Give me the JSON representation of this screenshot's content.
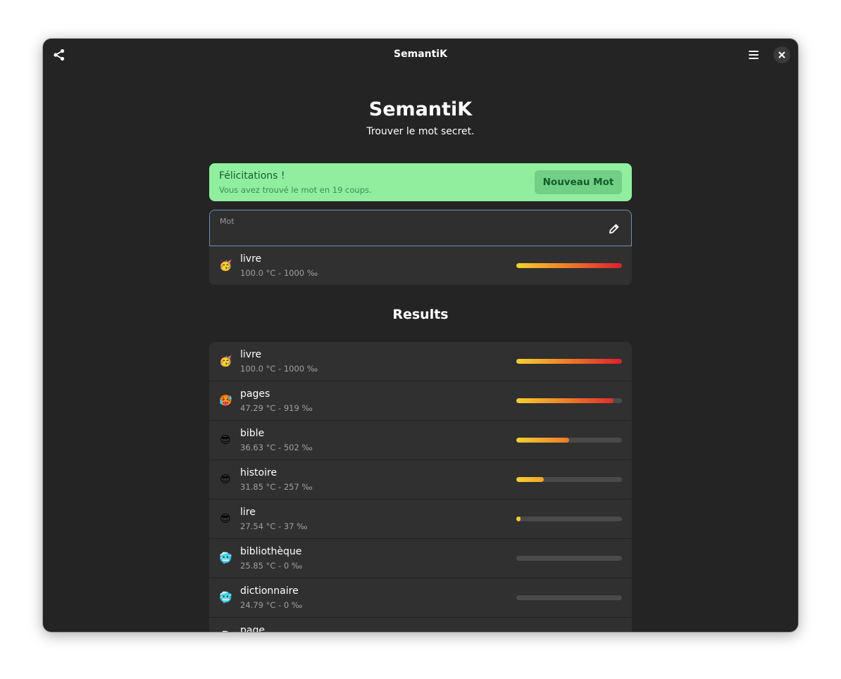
{
  "window": {
    "title": "SemantiK"
  },
  "header": {
    "title": "SemantiK",
    "subtitle": "Trouver le mot secret."
  },
  "banner": {
    "title": "Félicitations !",
    "subtitle": "Vous avez trouvé le mot en 19 coups.",
    "button_label": "Nouveau Mot"
  },
  "entry": {
    "label": "Mot",
    "value": ""
  },
  "current_guess": {
    "emoji": "🥳",
    "word": "livre",
    "meta": "100.0 °C - 1000 ‰",
    "permille": 1000
  },
  "results": {
    "title": "Results",
    "items": [
      {
        "emoji": "🥳",
        "word": "livre",
        "meta": "100.0 °C - 1000 ‰",
        "permille": 1000
      },
      {
        "emoji": "🥵",
        "word": "pages",
        "meta": "47.29 °C - 919 ‰",
        "permille": 919
      },
      {
        "emoji": "😎",
        "word": "bible",
        "meta": "36.63 °C - 502 ‰",
        "permille": 502
      },
      {
        "emoji": "😎",
        "word": "histoire",
        "meta": "31.85 °C - 257 ‰",
        "permille": 257
      },
      {
        "emoji": "😎",
        "word": "lire",
        "meta": "27.54 °C - 37 ‰",
        "permille": 37
      },
      {
        "emoji": "🥶",
        "word": "bibliothèque",
        "meta": "25.85 °C - 0 ‰",
        "permille": 0
      },
      {
        "emoji": "🥶",
        "word": "dictionnaire",
        "meta": "24.79 °C - 0 ‰",
        "permille": 0
      },
      {
        "emoji": "🥶",
        "word": "page",
        "meta": "",
        "permille": 0
      }
    ]
  },
  "colors": {
    "window_bg": "#242424",
    "card_bg": "#303030",
    "success_bg": "#8fef9f",
    "success_button": "#72cf86",
    "bar_start": "#f5d031",
    "bar_end": "#dd1f2c"
  },
  "icons": {
    "share": "share-icon",
    "menu": "hamburger-menu-icon",
    "close": "close-icon",
    "edit": "pencil-icon"
  }
}
